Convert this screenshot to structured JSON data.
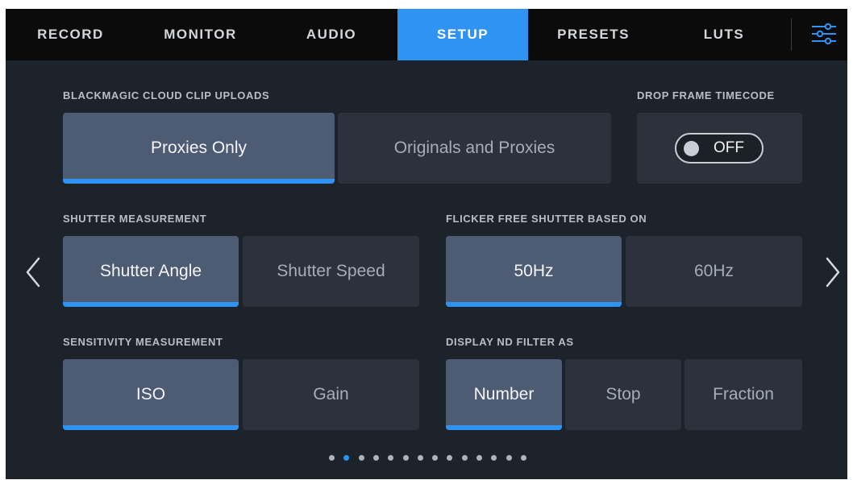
{
  "tabs": [
    {
      "label": "RECORD",
      "active": false
    },
    {
      "label": "MONITOR",
      "active": false
    },
    {
      "label": "AUDIO",
      "active": false
    },
    {
      "label": "SETUP",
      "active": true
    },
    {
      "label": "PRESETS",
      "active": false
    },
    {
      "label": "LUTS",
      "active": false
    }
  ],
  "settings_icon": "sliders-icon",
  "colors": {
    "accent": "#2e93f3",
    "background": "#1d232b",
    "selected": "#4d5b73",
    "unselected": "#2b323c"
  },
  "cloud_uploads": {
    "label": "BLACKMAGIC CLOUD CLIP UPLOADS",
    "options": [
      "Proxies Only",
      "Originals and Proxies"
    ],
    "selected": "Proxies Only"
  },
  "drop_frame": {
    "label": "DROP FRAME TIMECODE",
    "state": "OFF"
  },
  "shutter_measurement": {
    "label": "SHUTTER MEASUREMENT",
    "options": [
      "Shutter Angle",
      "Shutter Speed"
    ],
    "selected": "Shutter Angle"
  },
  "flicker_free": {
    "label": "FLICKER FREE SHUTTER BASED ON",
    "options": [
      "50Hz",
      "60Hz"
    ],
    "selected": "50Hz"
  },
  "sensitivity": {
    "label": "SENSITIVITY MEASUREMENT",
    "options": [
      "ISO",
      "Gain"
    ],
    "selected": "ISO"
  },
  "nd_filter": {
    "label": "DISPLAY ND FILTER AS",
    "options": [
      "Number",
      "Stop",
      "Fraction"
    ],
    "selected": "Number"
  },
  "nav": {
    "prev_icon": "chevron-left-icon",
    "next_icon": "chevron-right-icon"
  },
  "pagination": {
    "total": 14,
    "current": 2
  }
}
